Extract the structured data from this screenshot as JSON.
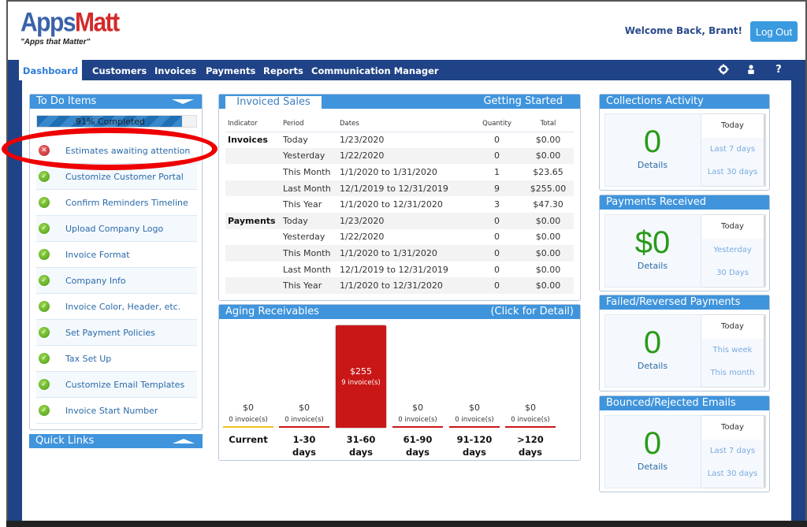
{
  "header": {
    "logo_part1": "Apps",
    "logo_part2": "Matt",
    "tagline": "\"Apps that Matter\"",
    "welcome": "Welcome Back, Brant!",
    "logout_label": "Log Out"
  },
  "nav": {
    "items": [
      {
        "label": "Dashboard",
        "active": true
      },
      {
        "label": "Customers"
      },
      {
        "label": "Invoices"
      },
      {
        "label": "Payments"
      },
      {
        "label": "Reports"
      },
      {
        "label": "Communication Manager"
      }
    ],
    "icons": [
      "gear-icon",
      "user-icon",
      "help-icon"
    ],
    "help_glyph": "?"
  },
  "todo": {
    "title": "To Do Items",
    "progress_percent": 91,
    "progress_label": "91% Completed",
    "items": [
      {
        "label": "Estimates awaiting attention",
        "status": "incomplete"
      },
      {
        "label": "Customize Customer Portal",
        "status": "complete"
      },
      {
        "label": "Confirm Reminders Timeline",
        "status": "complete"
      },
      {
        "label": "Upload Company Logo",
        "status": "complete"
      },
      {
        "label": "Invoice Format",
        "status": "complete"
      },
      {
        "label": "Company Info",
        "status": "complete"
      },
      {
        "label": "Invoice Color, Header, etc.",
        "status": "complete"
      },
      {
        "label": "Set Payment Policies",
        "status": "complete"
      },
      {
        "label": "Tax Set Up",
        "status": "complete"
      },
      {
        "label": "Customize Email Templates",
        "status": "complete"
      },
      {
        "label": "Invoice Start Number",
        "status": "complete"
      }
    ]
  },
  "quick_links": {
    "title": "Quick Links"
  },
  "sales": {
    "tab": "Invoiced Sales",
    "right_link": "Getting Started",
    "columns": [
      "Indicator",
      "Period",
      "Dates",
      "Quantity",
      "Total"
    ],
    "rows": [
      {
        "indicator": "Invoices",
        "period": "Today",
        "dates": "1/23/2020",
        "qty": "0",
        "total": "$0.00"
      },
      {
        "indicator": "",
        "period": "Yesterday",
        "dates": "1/22/2020",
        "qty": "0",
        "total": "$0.00"
      },
      {
        "indicator": "",
        "period": "This Month",
        "dates": "1/1/2020 to 1/31/2020",
        "qty": "1",
        "total": "$23.65"
      },
      {
        "indicator": "",
        "period": "Last Month",
        "dates": "12/1/2019 to 12/31/2019",
        "qty": "9",
        "total": "$255.00"
      },
      {
        "indicator": "",
        "period": "This Year",
        "dates": "1/1/2020 to 12/31/2020",
        "qty": "3",
        "total": "$47.30"
      },
      {
        "indicator": "Payments",
        "period": "Today",
        "dates": "1/23/2020",
        "qty": "0",
        "total": "$0.00"
      },
      {
        "indicator": "",
        "period": "Yesterday",
        "dates": "1/22/2020",
        "qty": "0",
        "total": "$0.00"
      },
      {
        "indicator": "",
        "period": "This Month",
        "dates": "1/1/2020 to 1/31/2020",
        "qty": "0",
        "total": "$0.00"
      },
      {
        "indicator": "",
        "period": "Last Month",
        "dates": "12/1/2019 to 12/31/2019",
        "qty": "0",
        "total": "$0.00"
      },
      {
        "indicator": "",
        "period": "This Year",
        "dates": "1/1/2020 to 12/31/2020",
        "qty": "0",
        "total": "$0.00"
      }
    ]
  },
  "aging": {
    "title": "Aging Receivables",
    "right_link": "(Click for Detail)",
    "buckets": [
      {
        "label1": "Current",
        "label2": "",
        "amount": "$0",
        "invoices": "0 invoice(s)",
        "value": 0,
        "line_color": "#f0c020"
      },
      {
        "label1": "1-30",
        "label2": "days",
        "amount": "$0",
        "invoices": "0 invoice(s)",
        "value": 0,
        "line_color": "#c91616"
      },
      {
        "label1": "31-60",
        "label2": "days",
        "amount": "$255",
        "invoices": "9 invoice(s)",
        "value": 255,
        "line_color": "#c91616"
      },
      {
        "label1": "61-90",
        "label2": "days",
        "amount": "$0",
        "invoices": "0 invoice(s)",
        "value": 0,
        "line_color": "#c91616"
      },
      {
        "label1": "91-120",
        "label2": "days",
        "amount": "$0",
        "invoices": "0 invoice(s)",
        "value": 0,
        "line_color": "#c91616"
      },
      {
        "label1": ">120",
        "label2": "days",
        "amount": "$0",
        "invoices": "0 invoice(s)",
        "value": 0,
        "line_color": "#c91616"
      }
    ]
  },
  "stats": [
    {
      "title": "Collections Activity",
      "value": "0",
      "details": "Details",
      "options": [
        "Today",
        "Last 7 days",
        "Last 30 days"
      ]
    },
    {
      "title": "Payments Received",
      "value": "$0",
      "details": "Details",
      "options": [
        "Today",
        "Yesterday",
        "30 Days"
      ]
    },
    {
      "title": "Failed/Reversed Payments",
      "value": "0",
      "details": "Details",
      "options": [
        "Today",
        "This week",
        "This month"
      ]
    },
    {
      "title": "Bounced/Rejected Emails",
      "value": "0",
      "details": "Details",
      "options": [
        "Today",
        "Last 7 days",
        "Last 30 days"
      ]
    }
  ],
  "colors": {
    "nav_bg": "#1f4386",
    "panel_head": "#3f94dc",
    "accent_red": "#c91616",
    "stat_green": "#2a9a1a",
    "logout_btn": "#3a9ae0"
  }
}
